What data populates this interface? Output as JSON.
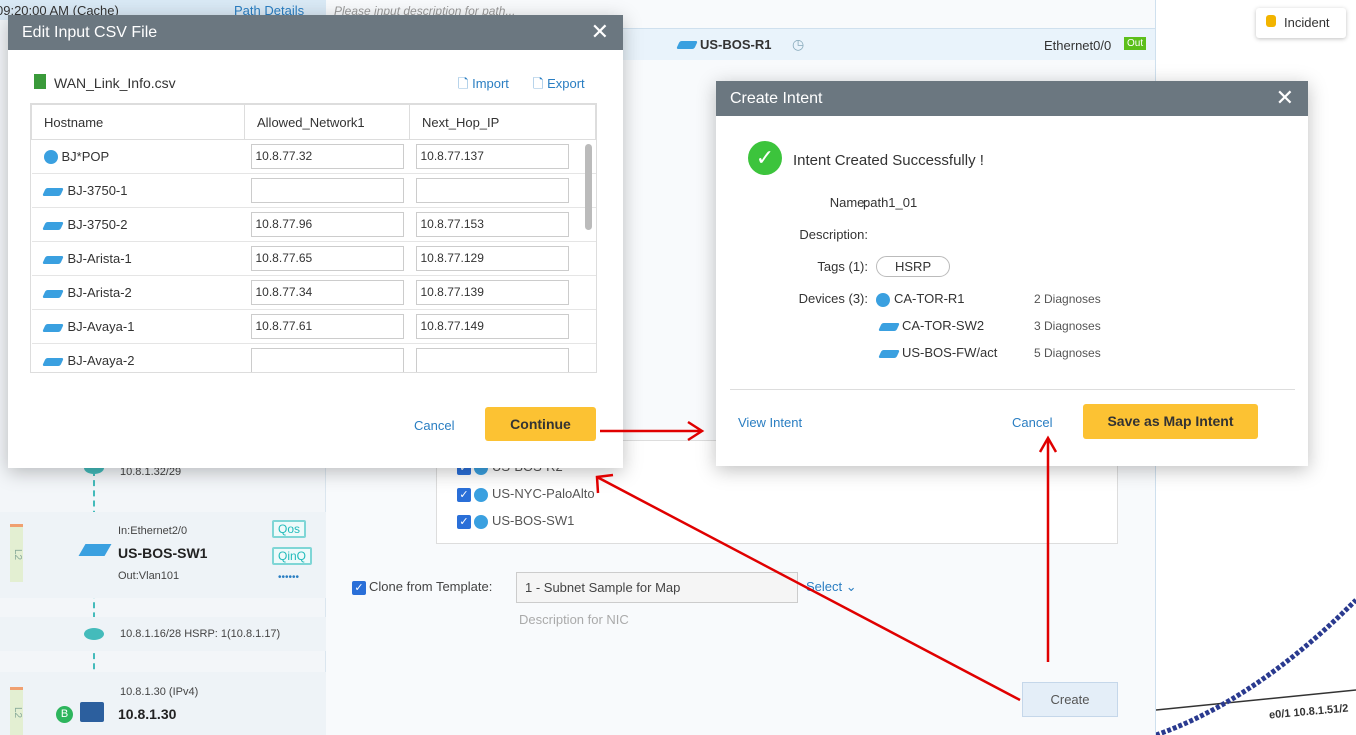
{
  "left_panel": {
    "time": "09:20:00 AM (Cache)",
    "path_details": "Path Details",
    "subnet1": "10.8.1.32/29",
    "device_in": "In:Ethernet2/0",
    "device_name": "US-BOS-SW1",
    "device_out": "Out:Vlan101",
    "tags": [
      "Qos",
      "QinQ"
    ],
    "more": "••••••",
    "l2": "L2",
    "subnet2": "10.8.1.16/28 HSRP: 1(10.8.1.17)",
    "host_ip_label": "10.8.1.30 (IPv4)",
    "host_name": "10.8.1.30",
    "badge": "B"
  },
  "middle_panel": {
    "description_placeholder": "Please input description for path...",
    "hop_device": "US-BOS-R1",
    "hop_interface": "Ethernet0/0",
    "hop_dir": "Out",
    "device_list": [
      "US-BOS-R2",
      "US-NYC-PaloAlto",
      "US-BOS-SW1"
    ],
    "clone_label": "Clone from Template:",
    "template_value": "1 - Subnet Sample for Map",
    "select_label": "Select",
    "description_hint": "Description for NIC",
    "create_button": "Create"
  },
  "map": {
    "incident_button": "Incident",
    "link_label": "e0/1 10.8.1.51/2"
  },
  "csv_modal": {
    "title": "Edit Input CSV File",
    "file_name": "WAN_Link_Info.csv",
    "import": "Import",
    "export": "Export",
    "columns": [
      "Hostname",
      "Allowed_Network1",
      "Next_Hop_IP"
    ],
    "rows": [
      {
        "host": "BJ*POP",
        "icon": "router",
        "net": "10.8.77.32",
        "hop": "10.8.77.137"
      },
      {
        "host": "BJ-3750-1",
        "icon": "switch",
        "net": "",
        "hop": ""
      },
      {
        "host": "BJ-3750-2",
        "icon": "switch",
        "net": "10.8.77.96",
        "hop": "10.8.77.153"
      },
      {
        "host": "BJ-Arista-1",
        "icon": "switch",
        "net": "10.8.77.65",
        "hop": "10.8.77.129"
      },
      {
        "host": "BJ-Arista-2",
        "icon": "switch",
        "net": "10.8.77.34",
        "hop": "10.8.77.139"
      },
      {
        "host": "BJ-Avaya-1",
        "icon": "switch",
        "net": "10.8.77.61",
        "hop": "10.8.77.149"
      },
      {
        "host": "BJ-Avaya-2",
        "icon": "switch",
        "net": "",
        "hop": ""
      }
    ],
    "cancel": "Cancel",
    "continue": "Continue"
  },
  "intent_modal": {
    "title": "Create Intent",
    "success": "Intent Created Successfully !",
    "name_label": "Name:",
    "name": "path1_01",
    "description_label": "Description:",
    "tags_label": "Tags (1):",
    "tag": "HSRP",
    "devices_label": "Devices (3):",
    "devices": [
      {
        "name": "CA-TOR-R1",
        "diag": "2 Diagnoses"
      },
      {
        "name": "CA-TOR-SW2",
        "diag": "3 Diagnoses"
      },
      {
        "name": "US-BOS-FW/act",
        "diag": "5 Diagnoses"
      }
    ],
    "view_intent": "View Intent",
    "cancel": "Cancel",
    "save": "Save as Map Intent"
  },
  "colors": {
    "header": "#6b7780",
    "accent": "#fcc233",
    "link": "#2a7ec2",
    "arrow": "#e00000"
  }
}
